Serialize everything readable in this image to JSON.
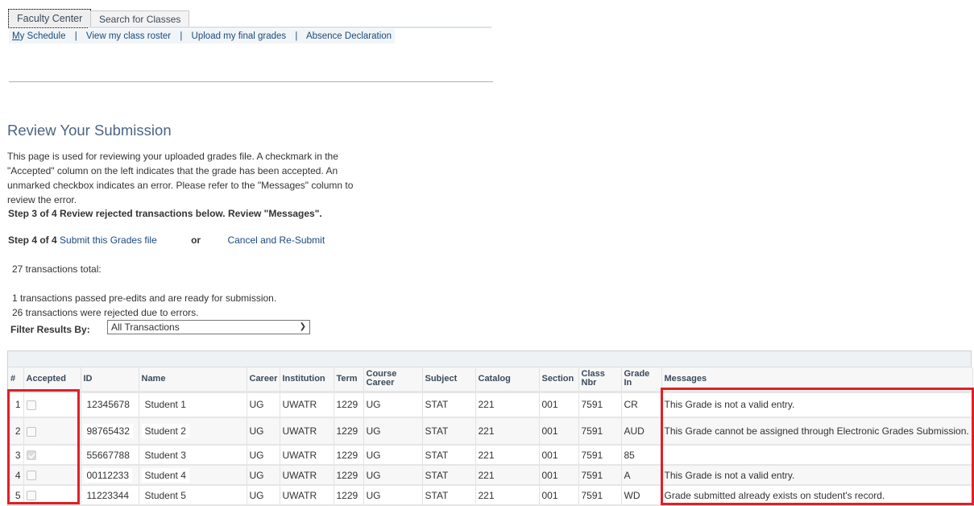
{
  "tabs": [
    {
      "label": "Faculty Center",
      "active": true
    },
    {
      "label": "Search for Classes",
      "active": false
    }
  ],
  "subnav": {
    "items": [
      "My Schedule",
      "View my class roster",
      "Upload my final grades",
      "Absence Declaration"
    ],
    "separator": "|"
  },
  "page": {
    "title": "Review Your Submission",
    "description": "This page is used for reviewing your uploaded grades file. A checkmark in the \"Accepted\" column on the left indicates that the grade has been accepted. An unmarked checkbox indicates an error. Please refer to the \"Messages\" column to review the error.",
    "step3": "Step 3 of 4 Review rejected transactions below. Review \"Messages\".",
    "step4_label": "Step 4 of 4",
    "submit_link": "Submit this Grades file",
    "or_label": "or",
    "cancel_link": "Cancel and Re-Submit",
    "total_text": "27 transactions total:",
    "passed_text": "1 transactions passed pre-edits and are ready for submission.",
    "rejected_text": "26 transactions were rejected due to errors.",
    "filter_label": "Filter Results By:",
    "filter_value": "All Transactions"
  },
  "table": {
    "headers": {
      "num": "#",
      "accepted": "Accepted",
      "id": "ID",
      "name": "Name",
      "career": "Career",
      "institution": "Institution",
      "term": "Term",
      "course_career": "Course Career",
      "subject": "Subject",
      "catalog": "Catalog",
      "section": "Section",
      "class_nbr": "Class Nbr",
      "grade_in": "Grade In",
      "messages": "Messages"
    },
    "rows": [
      {
        "num": "1",
        "accepted": false,
        "id": "12345678",
        "name": "Student 1",
        "career": "UG",
        "institution": "UWATR",
        "term": "1229",
        "course_career": "UG",
        "subject": "STAT",
        "catalog": "221",
        "section": "001",
        "class_nbr": "7591",
        "grade_in": "CR",
        "message": "This Grade is not a valid entry."
      },
      {
        "num": "2",
        "accepted": false,
        "id": "98765432",
        "name": "Student 2",
        "career": "UG",
        "institution": "UWATR",
        "term": "1229",
        "course_career": "UG",
        "subject": "STAT",
        "catalog": "221",
        "section": "001",
        "class_nbr": "7591",
        "grade_in": "AUD",
        "message": "This Grade cannot be assigned through Electronic Grades Submission."
      },
      {
        "num": "3",
        "accepted": true,
        "id": "55667788",
        "name": "Student 3",
        "career": "UG",
        "institution": "UWATR",
        "term": "1229",
        "course_career": "UG",
        "subject": "STAT",
        "catalog": "221",
        "section": "001",
        "class_nbr": "7591",
        "grade_in": "85",
        "message": ""
      },
      {
        "num": "4",
        "accepted": false,
        "id": "00112233",
        "name": "Student 4",
        "career": "UG",
        "institution": "UWATR",
        "term": "1229",
        "course_career": "UG",
        "subject": "STAT",
        "catalog": "221",
        "section": "001",
        "class_nbr": "7591",
        "grade_in": "A",
        "message": "This Grade is not a valid entry."
      },
      {
        "num": "5",
        "accepted": false,
        "id": "11223344",
        "name": "Student 5",
        "career": "UG",
        "institution": "UWATR",
        "term": "1229",
        "course_career": "UG",
        "subject": "STAT",
        "catalog": "221",
        "section": "001",
        "class_nbr": "7591",
        "grade_in": "WD",
        "message": "Grade submitted already exists on student's record."
      }
    ]
  },
  "colors": {
    "link": "#1b4a7e",
    "title": "#4a6484",
    "highlight_box": "#e31e26"
  }
}
